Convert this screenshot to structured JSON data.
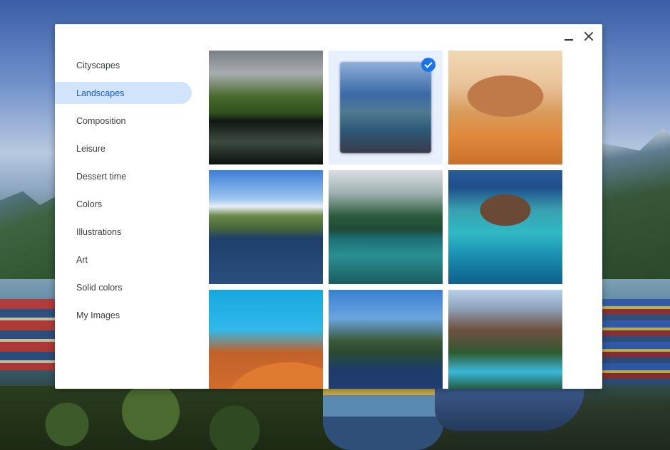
{
  "window": {
    "minimize_icon": "minimize-icon",
    "close_icon": "close-icon"
  },
  "sidebar": {
    "items": [
      {
        "label": "Cityscapes",
        "active": false
      },
      {
        "label": "Landscapes",
        "active": true
      },
      {
        "label": "Composition",
        "active": false
      },
      {
        "label": "Leisure",
        "active": false
      },
      {
        "label": "Dessert time",
        "active": false
      },
      {
        "label": "Colors",
        "active": false
      },
      {
        "label": "Illustrations",
        "active": false
      },
      {
        "label": "Art",
        "active": false
      },
      {
        "label": "Solid colors",
        "active": false
      },
      {
        "label": "My Images",
        "active": false
      }
    ]
  },
  "gallery": {
    "selected_index": 1,
    "selected_icon": "checkmark-circle-icon",
    "tiles": [
      {
        "subject": "mountain-lake-reflection"
      },
      {
        "subject": "lake-with-boats"
      },
      {
        "subject": "desert-mesa"
      },
      {
        "subject": "sea-cliffs"
      },
      {
        "subject": "misty-forest-lake"
      },
      {
        "subject": "coral-reef-island"
      },
      {
        "subject": "orange-sand-dune"
      },
      {
        "subject": "lake-dock"
      },
      {
        "subject": "turquoise-mountain-lake"
      }
    ]
  },
  "colors": {
    "accent": "#1a73e8",
    "active_nav_bg": "#d2e3fc",
    "active_nav_text": "#1a5fc7",
    "selected_tile_bg": "#e8f0fe"
  }
}
